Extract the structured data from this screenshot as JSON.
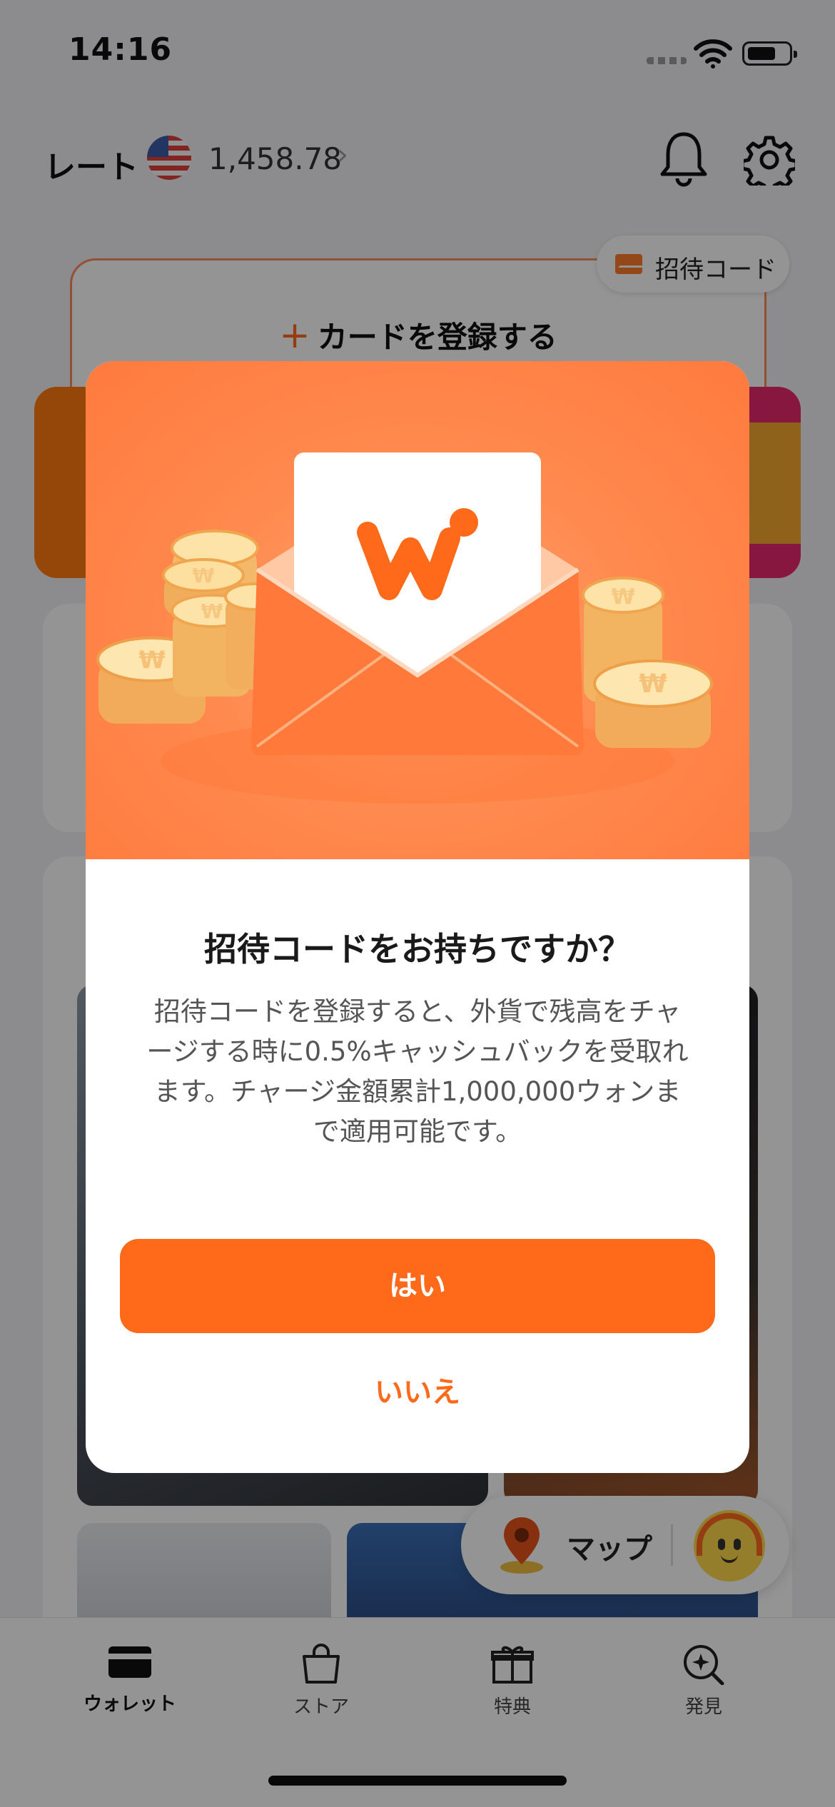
{
  "status_bar": {
    "time": "14:16"
  },
  "header": {
    "rate_label": "レート",
    "rate_value": "1,458.78",
    "rate_chevron": "›"
  },
  "invite_chip": {
    "label": "招待コード"
  },
  "card_register": {
    "plus": "+",
    "label": "カードを登録する"
  },
  "modal": {
    "title": "招待コードをお持ちですか？",
    "body": "招待コードを登録すると、外貨で残高をチャージする時に0.5%キャッシュバックを受取れます。チャージ金額累計1,000,000ウォンまで適用可能です。",
    "yes_label": "はい",
    "no_label": "いいえ"
  },
  "map_pill": {
    "label": "マップ"
  },
  "tabbar": {
    "items": [
      {
        "label": "ウォレット",
        "icon": "wallet-icon",
        "active": true
      },
      {
        "label": "ストア",
        "icon": "shopping-bag-icon"
      },
      {
        "label": "特典",
        "icon": "gift-icon"
      },
      {
        "label": "発見",
        "icon": "discover-icon"
      }
    ]
  },
  "colors": {
    "accent": "#ff6a1a",
    "overlay": "rgba(0,0,0,0.42)"
  }
}
